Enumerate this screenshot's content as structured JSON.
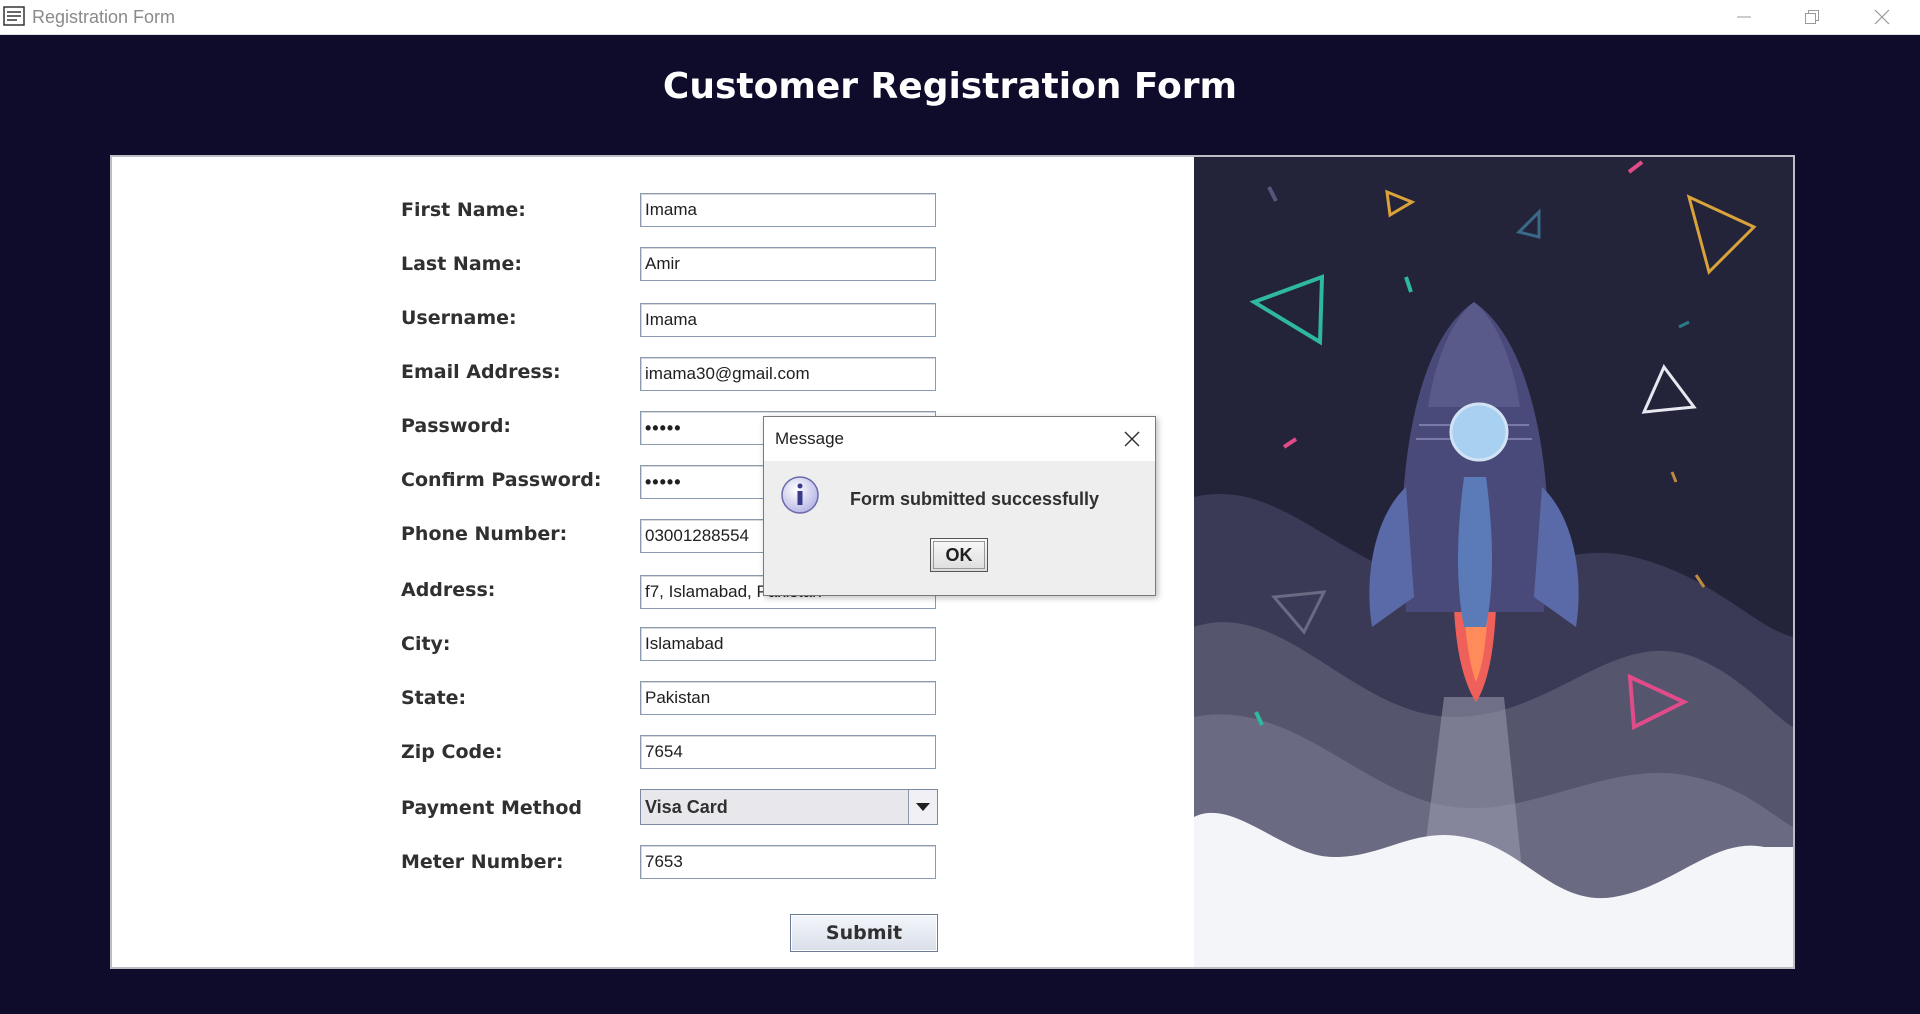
{
  "window": {
    "title": "Registration Form"
  },
  "page": {
    "title": "Customer Registration Form"
  },
  "form": {
    "fields": [
      {
        "label": "First Name:",
        "value": "Imama"
      },
      {
        "label": "Last Name:",
        "value": "Amir"
      },
      {
        "label": "Username:",
        "value": "Imama"
      },
      {
        "label": "Email Address:",
        "value": "imama30@gmail.com"
      },
      {
        "label": "Password:",
        "value": "•••••"
      },
      {
        "label": "Confirm Password:",
        "value": "•••••"
      },
      {
        "label": "Phone Number:",
        "value": "03001288554"
      },
      {
        "label": "Address:",
        "value": "f7, Islamabad, Pakistan"
      },
      {
        "label": "City:",
        "value": "Islamabad"
      },
      {
        "label": "State:",
        "value": "Pakistan"
      },
      {
        "label": "Zip Code:",
        "value": "7654"
      },
      {
        "label": "Payment Method",
        "value": "Visa Card"
      },
      {
        "label": "Meter Number:",
        "value": "7653"
      }
    ],
    "submit_label": "Submit"
  },
  "dialog": {
    "title": "Message",
    "message": "Form submitted successfully",
    "ok_label": "OK",
    "icon": "info-icon"
  },
  "colors": {
    "background": "#0f0b2b",
    "art_background": "#23233a",
    "accent_teal": "#2fb8a0",
    "accent_pink": "#e04c8a",
    "accent_gold": "#d9a33a"
  }
}
